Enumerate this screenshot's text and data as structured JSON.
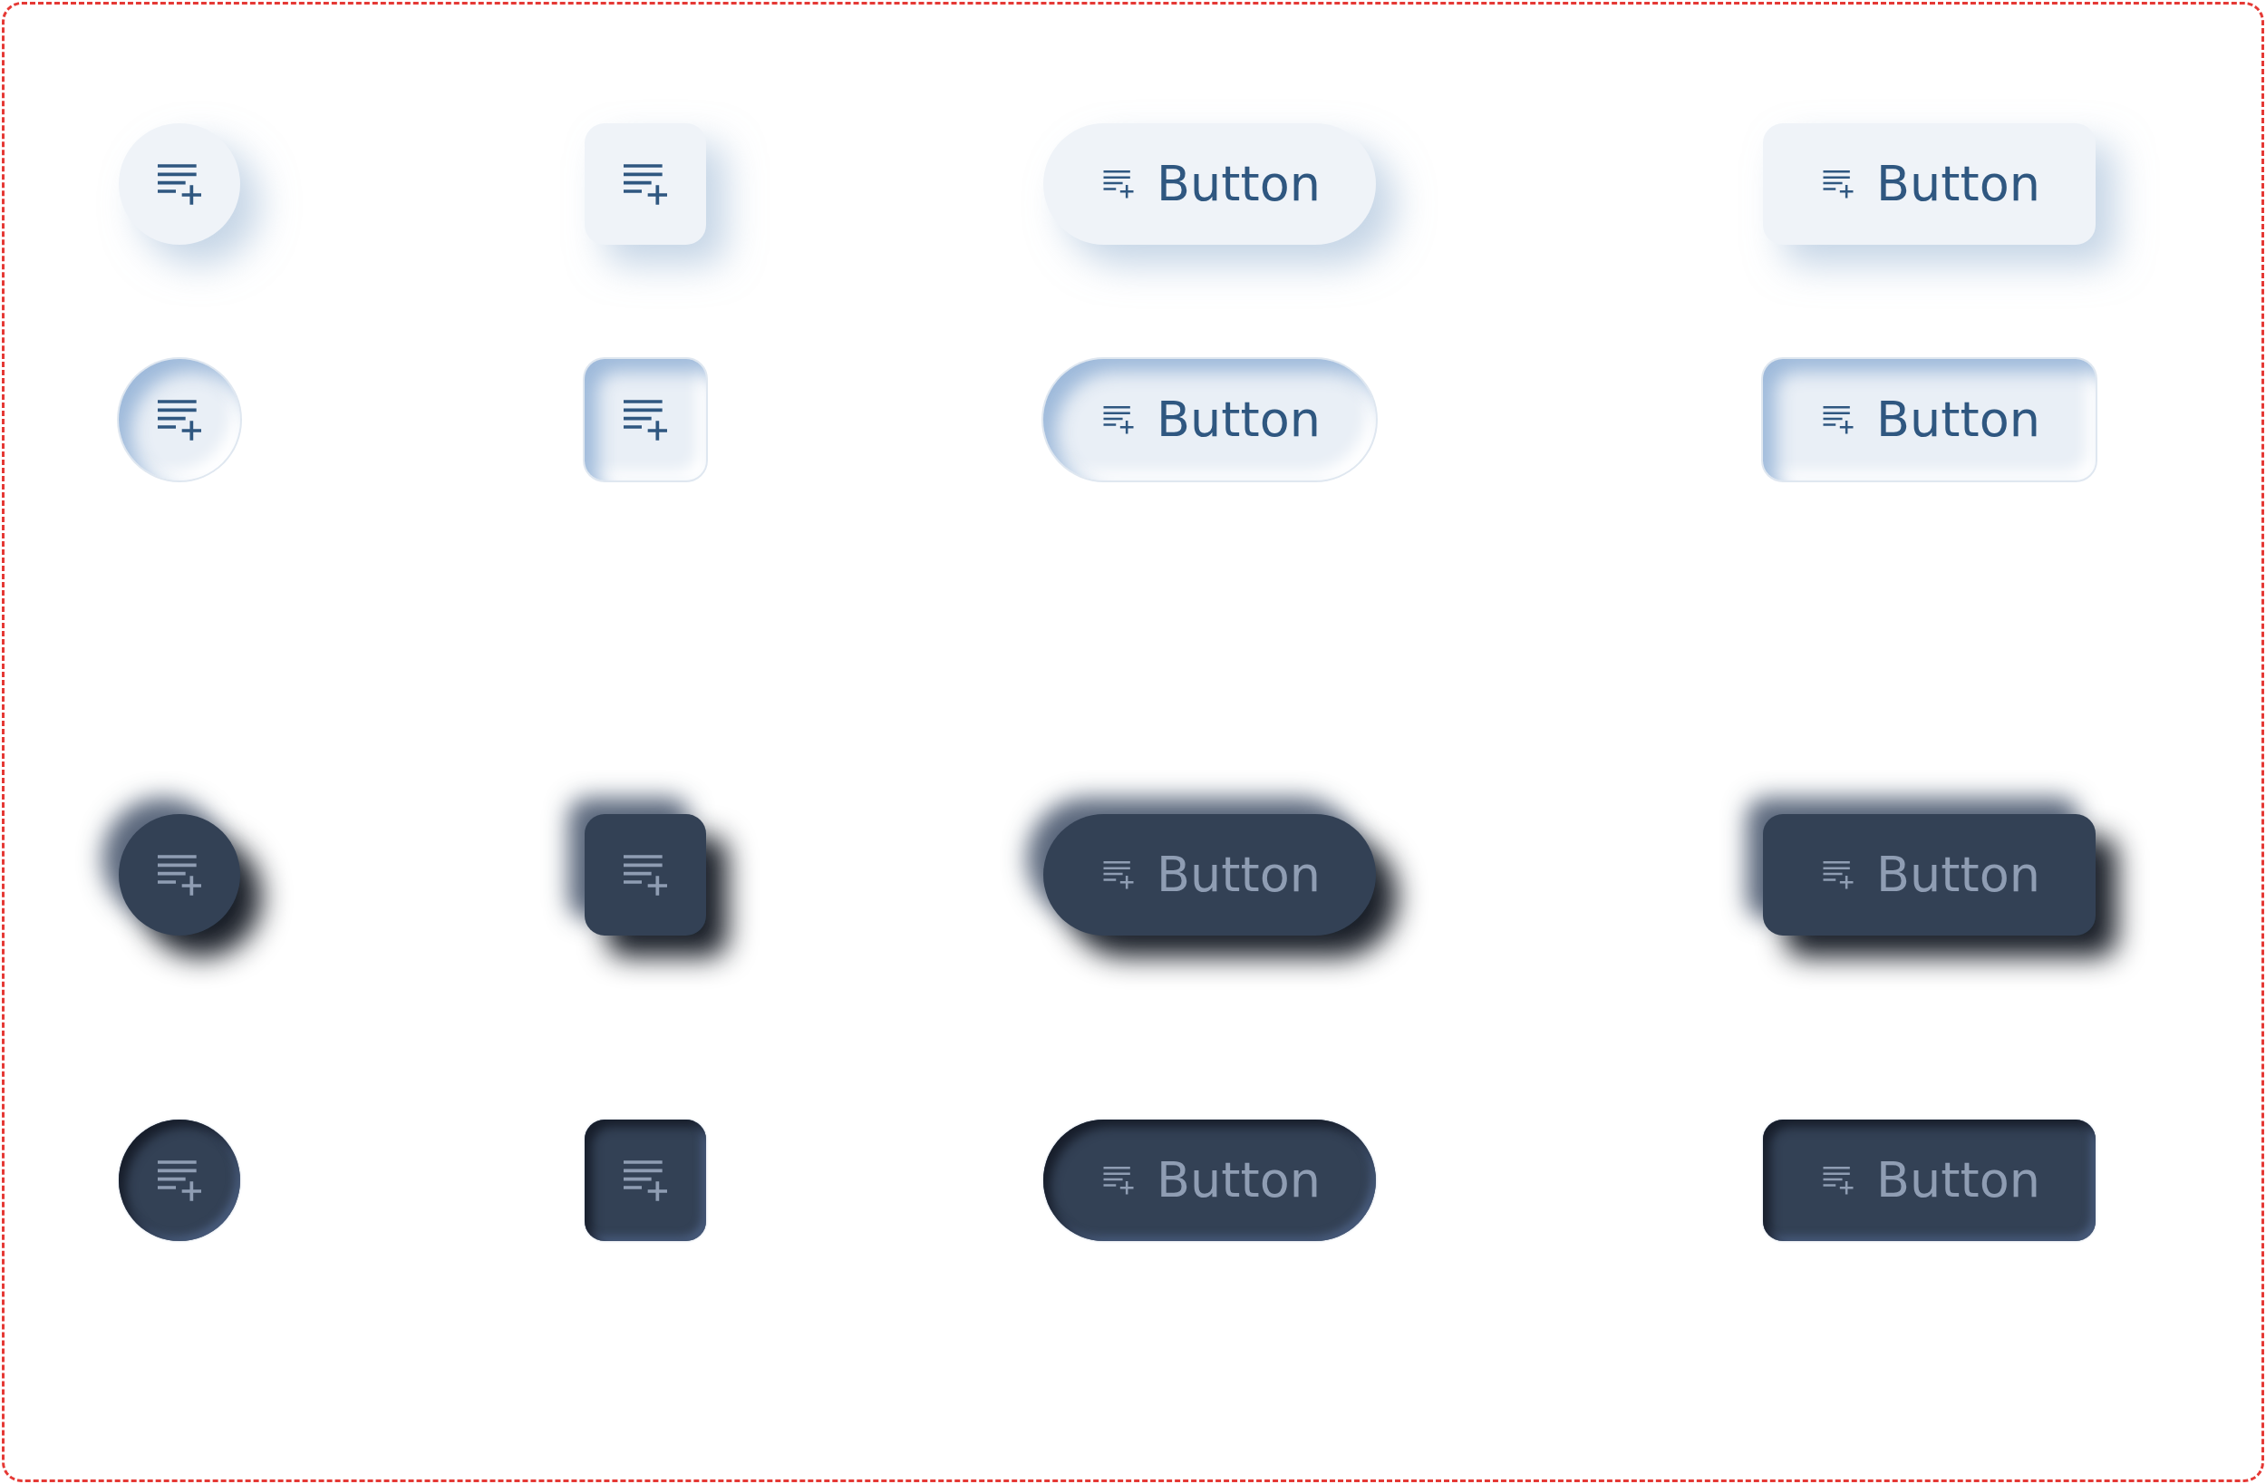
{
  "groups": [
    {
      "dark": false,
      "rows": [
        {
          "pressed": false,
          "buttons": [
            {
              "kind": "circle"
            },
            {
              "kind": "square"
            },
            {
              "kind": "pill",
              "label": "Button"
            },
            {
              "kind": "rounded",
              "label": "Button"
            }
          ]
        },
        {
          "pressed": true,
          "buttons": [
            {
              "kind": "circle"
            },
            {
              "kind": "square"
            },
            {
              "kind": "pill",
              "label": "Button"
            },
            {
              "kind": "rounded",
              "label": "Button"
            }
          ]
        }
      ]
    },
    {
      "dark": true,
      "rows": [
        {
          "pressed": false,
          "buttons": [
            {
              "kind": "circle"
            },
            {
              "kind": "square"
            },
            {
              "kind": "pill",
              "label": "Button"
            },
            {
              "kind": "rounded",
              "label": "Button"
            }
          ]
        },
        {
          "pressed": true,
          "buttons": [
            {
              "kind": "circle"
            },
            {
              "kind": "square"
            },
            {
              "kind": "pill",
              "label": "Button"
            },
            {
              "kind": "rounded",
              "label": "Button"
            }
          ]
        }
      ]
    }
  ]
}
